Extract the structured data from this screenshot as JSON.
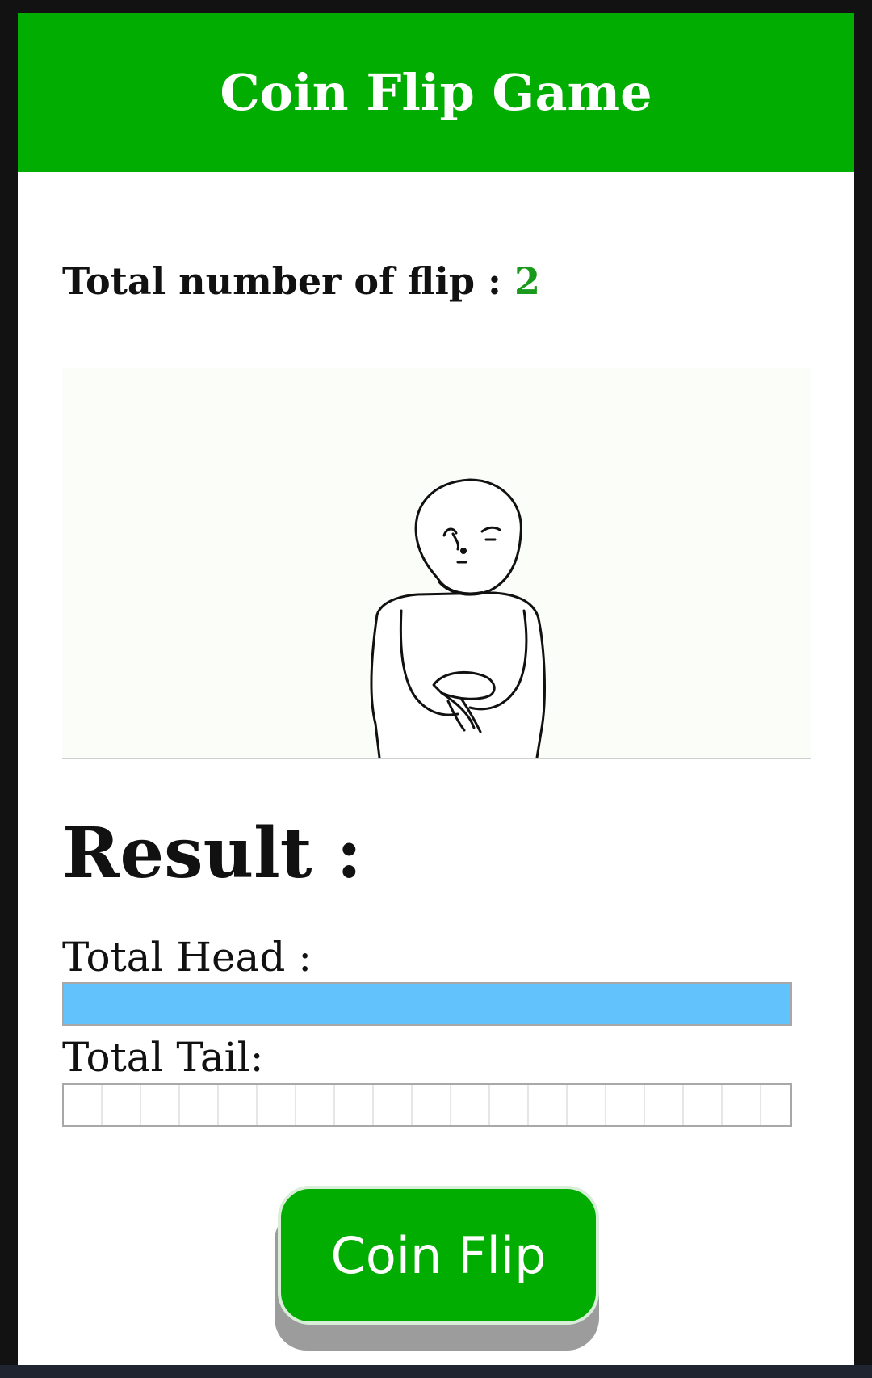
{
  "header": {
    "title": "Coin Flip Game"
  },
  "stats": {
    "flip_label": "Total number of flip :",
    "flip_count": "2"
  },
  "result": {
    "title": "Result :",
    "head_label": "Total Head :",
    "tail_label": "Total Tail:",
    "head_fraction": 1.0,
    "tail_fraction": 0.0
  },
  "actions": {
    "flip_button": "Coin Flip"
  },
  "colors": {
    "header_bg": "#00ad00",
    "count_color": "#1a9a1a",
    "head_bar": "#62c2fb",
    "button_bg": "#00ad00"
  },
  "icons": {
    "animation": "coin-flip-character-illustration"
  }
}
